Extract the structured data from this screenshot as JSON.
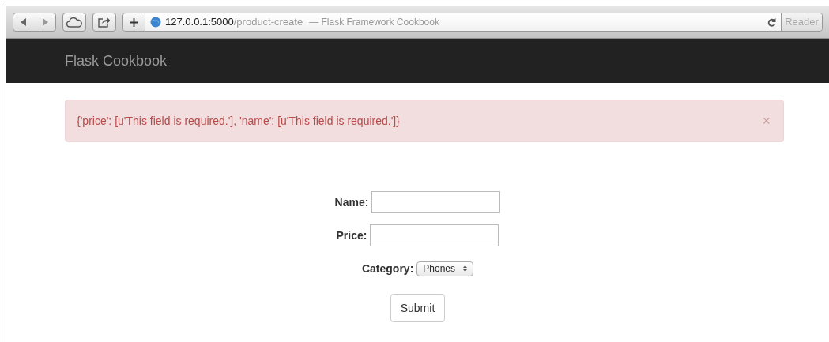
{
  "browser": {
    "url_host": "127.0.0.1:5000",
    "url_path": "/product-create",
    "page_title": "— Flask Framework Cookbook",
    "reader_button": "Reader"
  },
  "navbar": {
    "brand": "Flask Cookbook"
  },
  "alert": {
    "message": "{'price': [u'This field is required.'], 'name': [u'This field is required.']}",
    "close": "×"
  },
  "form": {
    "fields": [
      {
        "kind": "text",
        "label": "Name:"
      },
      {
        "kind": "text",
        "label": "Price:"
      },
      {
        "kind": "select",
        "label": "Category:",
        "value": "Phones"
      }
    ],
    "submit": "Submit"
  }
}
